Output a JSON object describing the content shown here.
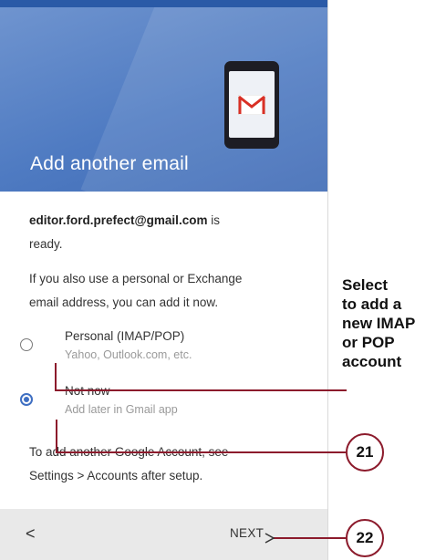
{
  "header": {
    "title": "Add another email"
  },
  "content": {
    "ready_email": "editor.ford.prefect@gmail.com",
    "ready_suffix": " is",
    "ready_word": "ready.",
    "info_line1": "If you also use a personal or Exchange",
    "info_line2": "email address, you can add it now."
  },
  "options": [
    {
      "label": "Personal (IMAP/POP)",
      "sublabel": "Yahoo, Outlook.com, etc.",
      "selected": false
    },
    {
      "label": "Not now",
      "sublabel": "Add later in Gmail app",
      "selected": true
    }
  ],
  "footer": {
    "line1": "To add another Google Account, see",
    "line2": "Settings > Accounts after setup."
  },
  "nav": {
    "back_label": "<",
    "next_label": "NEXT",
    "next_icon": "arrow-right-icon"
  },
  "callout": {
    "line1": "Select",
    "line2": "to add a",
    "line3": "new IMAP",
    "line4": "or POP",
    "line5": "account"
  },
  "badges": {
    "step_21": "21",
    "step_22": "22"
  },
  "colors": {
    "header_blue": "#4f7bc2",
    "radio_blue": "#3f6fc2",
    "annotation_red": "#8c1b2c",
    "gmail_red": "#d93025"
  }
}
